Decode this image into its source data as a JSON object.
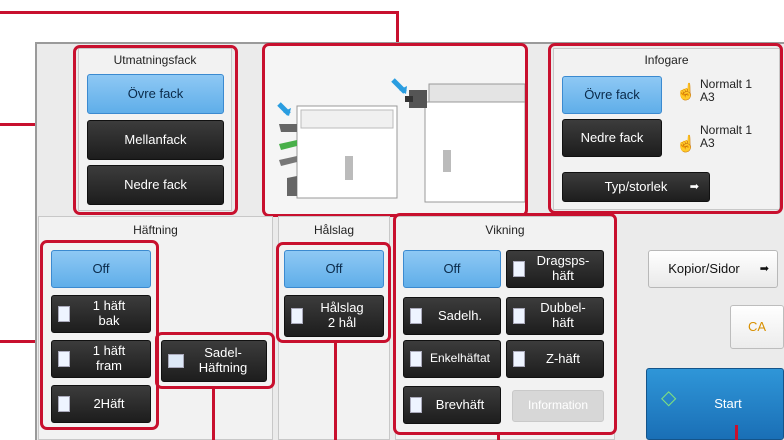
{
  "output_tray": {
    "title": "Utmatningsfack",
    "upper": "Övre fack",
    "middle": "Mellanfack",
    "lower": "Nedre fack"
  },
  "inserter": {
    "title": "Infogare",
    "upper": "Övre fack",
    "lower": "Nedre fack",
    "upper_info": [
      "Normalt 1",
      "A3"
    ],
    "lower_info": [
      "Normalt 1",
      "A3"
    ],
    "type_size": "Typ/storlek"
  },
  "stapling": {
    "title": "Häftning",
    "off": "Off",
    "one_back": "1 häft\nbak",
    "one_front": "1 häft\nfram",
    "two": "2Häft",
    "saddle": "Sadel-\nHäftning"
  },
  "punch": {
    "title": "Hålslag",
    "off": "Off",
    "two_hole": "Hålslag\n2 hål"
  },
  "folding": {
    "title": "Vikning",
    "off": "Off",
    "accordion": "Dragsps-\nhäft",
    "saddle": "Sadelh.",
    "double": "Dubbel-\nhäft",
    "single": "Enkelhäftat",
    "z": "Z-häft",
    "letter": "Brevhäft",
    "information": "Information"
  },
  "actions": {
    "copies_pages": "Kopior/Sidor",
    "ca": "CA",
    "start": "Start"
  },
  "colors": {
    "highlight": "#c8102e",
    "selected": "#6db7ee",
    "dark_button": "#2a2a2a",
    "start": "#2281c6"
  },
  "icons": {
    "inserter_hand": "hand-pointer-icon",
    "start": "diamond-start-icon",
    "arrow": "arrow-right-icon"
  }
}
